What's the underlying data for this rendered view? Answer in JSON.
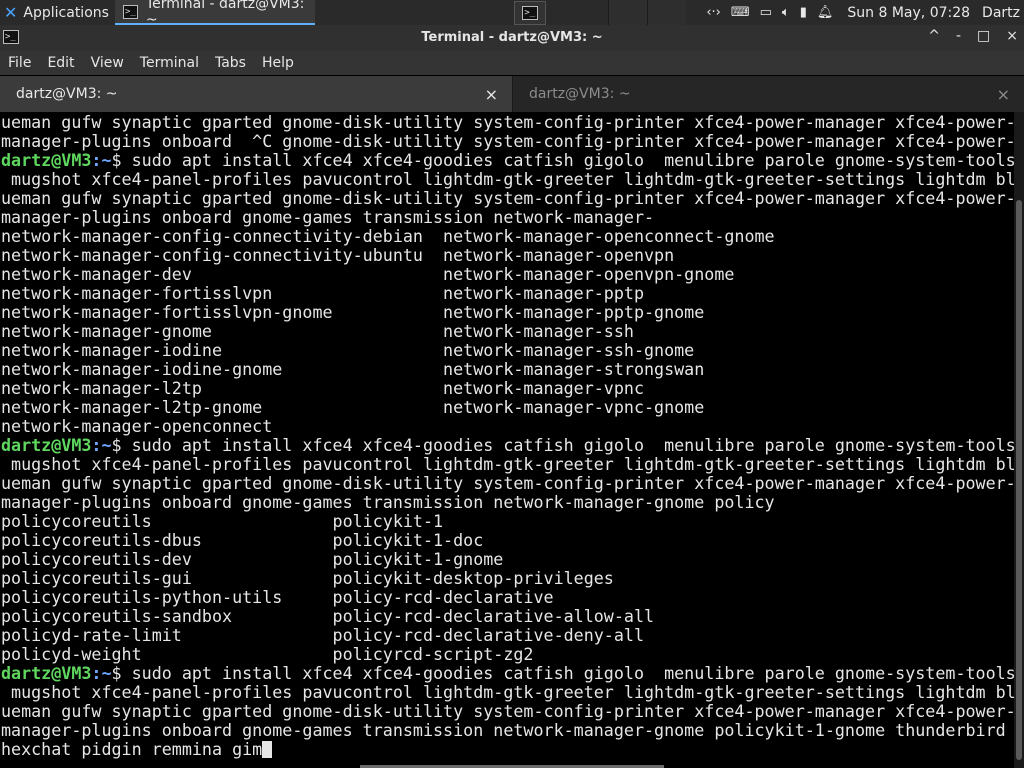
{
  "panel": {
    "applications_label": "Applications",
    "task_title": "Terminal - dartz@VM3: ~",
    "clock": "Sun  8 May, 07:28",
    "user": "Dartz",
    "tray_icons": [
      "network-icon",
      "keyboard-icon",
      "display-icon",
      "volume-icon",
      "battery-icon",
      "bell-icon"
    ]
  },
  "window": {
    "title": "Terminal - dartz@VM3: ~",
    "controls": [
      "^",
      "-",
      "□",
      "×"
    ]
  },
  "menu": [
    "File",
    "Edit",
    "View",
    "Terminal",
    "Tabs",
    "Help"
  ],
  "tabs": [
    {
      "label": "dartz@VM3: ~",
      "close": "×",
      "active": true
    },
    {
      "label": "dartz@VM3: ~",
      "close": "×",
      "active": false
    }
  ],
  "prompt": {
    "user": "dartz@VM3",
    "path": ":~",
    "symbol": "$ "
  },
  "terminal_lines": [
    {
      "text": "ueman gufw synaptic gparted gnome-disk-utility system-config-printer xfce4-power-manager xfce4-power-"
    },
    {
      "text": "manager-plugins onboard  ^C gnome-disk-utility system-config-printer xfce4-power-manager xfce4-power-"
    },
    {
      "prompt": true,
      "text": "sudo apt install xfce4 xfce4-goodies catfish gigolo  menulibre parole gnome-system-tools"
    },
    {
      "text": " mugshot xfce4-panel-profiles pavucontrol lightdm-gtk-greeter lightdm-gtk-greeter-settings lightdm bl"
    },
    {
      "text": "ueman gufw synaptic gparted gnome-disk-utility system-config-printer xfce4-power-manager xfce4-power-"
    },
    {
      "text": "manager-plugins onboard gnome-games transmission network-manager-"
    },
    {
      "text": "network-manager-config-connectivity-debian  network-manager-openconnect-gnome"
    },
    {
      "text": "network-manager-config-connectivity-ubuntu  network-manager-openvpn"
    },
    {
      "text": "network-manager-dev                         network-manager-openvpn-gnome"
    },
    {
      "text": "network-manager-fortisslvpn                 network-manager-pptp"
    },
    {
      "text": "network-manager-fortisslvpn-gnome           network-manager-pptp-gnome"
    },
    {
      "text": "network-manager-gnome                       network-manager-ssh"
    },
    {
      "text": "network-manager-iodine                      network-manager-ssh-gnome"
    },
    {
      "text": "network-manager-iodine-gnome                network-manager-strongswan"
    },
    {
      "text": "network-manager-l2tp                        network-manager-vpnc"
    },
    {
      "text": "network-manager-l2tp-gnome                  network-manager-vpnc-gnome"
    },
    {
      "text": "network-manager-openconnect"
    },
    {
      "prompt": true,
      "text": "sudo apt install xfce4 xfce4-goodies catfish gigolo  menulibre parole gnome-system-tools"
    },
    {
      "text": " mugshot xfce4-panel-profiles pavucontrol lightdm-gtk-greeter lightdm-gtk-greeter-settings lightdm bl"
    },
    {
      "text": "ueman gufw synaptic gparted gnome-disk-utility system-config-printer xfce4-power-manager xfce4-power-"
    },
    {
      "text": "manager-plugins onboard gnome-games transmission network-manager-gnome policy"
    },
    {
      "text": "policycoreutils                  policykit-1"
    },
    {
      "text": "policycoreutils-dbus             policykit-1-doc"
    },
    {
      "text": "policycoreutils-dev              policykit-1-gnome"
    },
    {
      "text": "policycoreutils-gui              policykit-desktop-privileges"
    },
    {
      "text": "policycoreutils-python-utils     policy-rcd-declarative"
    },
    {
      "text": "policycoreutils-sandbox          policy-rcd-declarative-allow-all"
    },
    {
      "text": "policyd-rate-limit               policy-rcd-declarative-deny-all"
    },
    {
      "text": "policyd-weight                   policyrcd-script-zg2"
    },
    {
      "prompt": true,
      "text": "sudo apt install xfce4 xfce4-goodies catfish gigolo  menulibre parole gnome-system-tools"
    },
    {
      "text": " mugshot xfce4-panel-profiles pavucontrol lightdm-gtk-greeter lightdm-gtk-greeter-settings lightdm bl"
    },
    {
      "text": "ueman gufw synaptic gparted gnome-disk-utility system-config-printer xfce4-power-manager xfce4-power-"
    },
    {
      "text": "manager-plugins onboard gnome-games transmission network-manager-gnome policykit-1-gnome thunderbird"
    },
    {
      "text": "hexchat pidgin remmina gim",
      "cursor": true
    }
  ],
  "colors": {
    "prompt_user": "#5fd75f",
    "prompt_path": "#6fa8ff",
    "terminal_bg": "#000000",
    "terminal_fg": "#e6e6e6"
  }
}
